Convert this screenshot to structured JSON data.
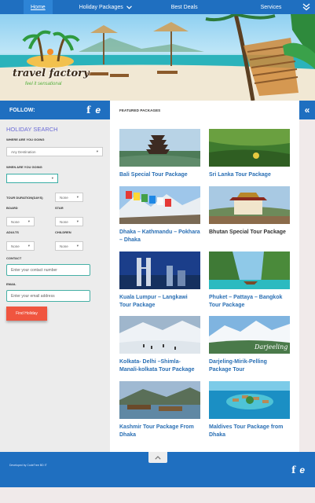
{
  "nav": {
    "home": "Home",
    "holiday_packages": "Holiday Packages",
    "best_deals": "Best Deals",
    "services": "Services"
  },
  "brand": {
    "name": "travel factory",
    "tagline": "feel it sensational"
  },
  "follow": {
    "label": "FOLLOW:"
  },
  "search": {
    "title": "HOLIDAY SEARCH",
    "where_going_label": "WHERE ARE YOU GOING",
    "where_going_value": "Any Destination",
    "when_going_label": "WHEN ARE YOU GOING",
    "duration_label": "TOUR DURATION(days)",
    "duration_value": "None",
    "board_label": "BOARD",
    "board_value": "None",
    "star_label": "STAR",
    "star_value": "None",
    "adults_label": "ADULTS",
    "adults_value": "None",
    "children_label": "CHILDREN",
    "children_value": "None",
    "contact_label": "CONTACT",
    "contact_placeholder": "Enter your contact number",
    "email_label": "EMAIL",
    "email_placeholder": "Enter your email address",
    "find_button": "Find Holiday"
  },
  "main": {
    "section_title": "FEATURED PACKAGES",
    "packages": [
      {
        "title": "Bali Special Tour Package"
      },
      {
        "title": "Sri Lanka Tour Package"
      },
      {
        "title": "Dhaka – Kathmandu – Pokhara – Dhaka"
      },
      {
        "title": "Bhutan Special Tour Package"
      },
      {
        "title": "Kuala Lumpur – Langkawi Tour Package"
      },
      {
        "title": "Phuket – Pattaya – Bangkok Tour Package"
      },
      {
        "title": "Kolkata- Delhi –Shimla- Manali-kolkata Tour Package"
      },
      {
        "title": "Darjeling-Mirik-Pelling Package Tour"
      },
      {
        "title": "Kashmir Tour Package From Dhaka"
      },
      {
        "title": "Maldives Tour Package from Dhaka"
      }
    ],
    "darjeeling_overlay": "Darjeeling"
  },
  "footer": {
    "credit": "Developed by CodeTree BD IT"
  },
  "colors": {
    "primary_blue": "#1f6fc0",
    "accent_red": "#f0553f",
    "link_blue": "#2a6fb4"
  }
}
